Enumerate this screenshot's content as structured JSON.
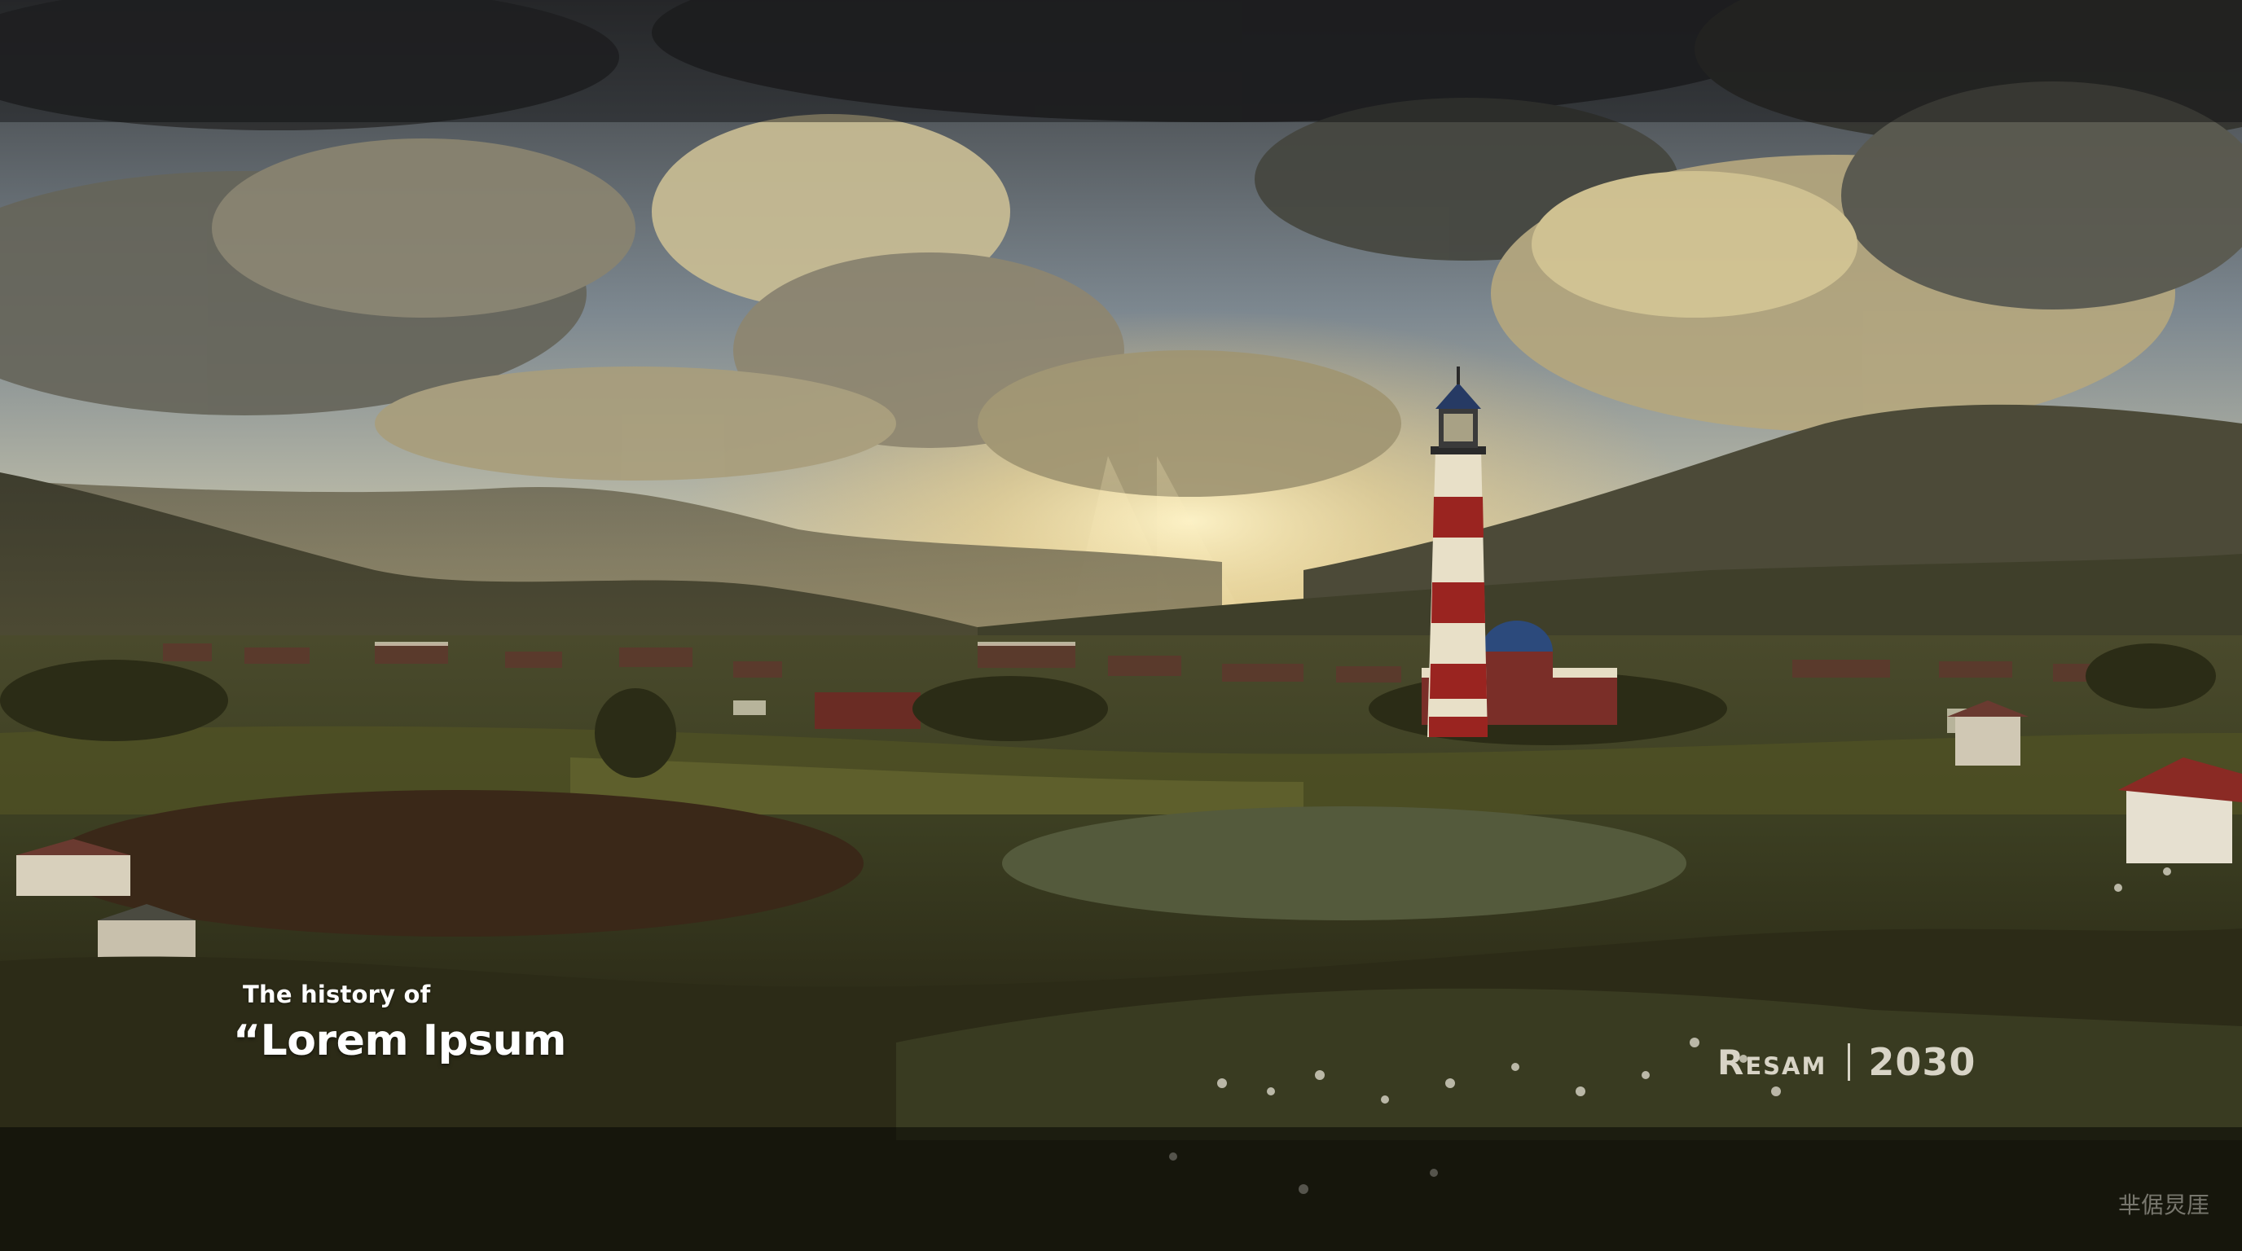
{
  "slide": {
    "subtitle": "The history of",
    "title": "“Lorem Ipsum",
    "brand_name": "Resam",
    "year": "2030",
    "corner_mark": "芈倨炅厓"
  },
  "background": {
    "scene": "sunset-valley-lighthouse-photo"
  },
  "colors": {
    "text_primary": "#ffffff",
    "text_brand": "#d8d4c6",
    "lighthouse_red": "#9a2420",
    "dome_blue": "#2c4a7c"
  }
}
